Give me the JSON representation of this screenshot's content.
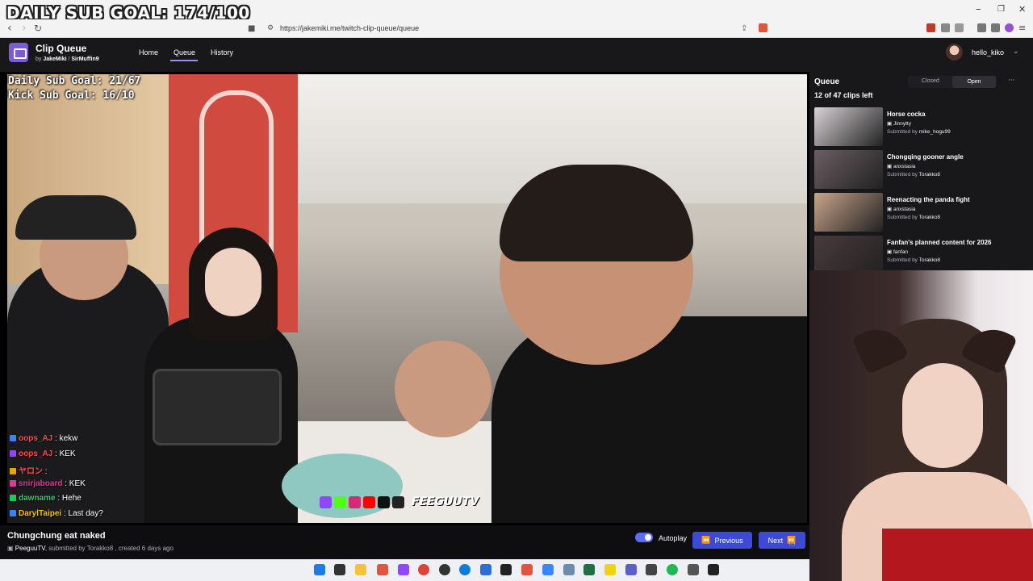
{
  "overlay": {
    "daily_sub_goal_top": "DAILY SUB GOAL: 174/100",
    "daily_sub_goal": "Daily Sub Goal: 21/67",
    "kick_sub_goal": "Kick Sub Goal: 16/10"
  },
  "browser": {
    "url": "https://jakemiki.me/twitch-clip-queue/queue",
    "window_controls": [
      "–",
      "❐",
      "✕"
    ]
  },
  "app": {
    "title": "Clip Queue",
    "by_prefix": "by",
    "authors": [
      "JakeMiki",
      "SirMuffin9"
    ],
    "nav": [
      "Home",
      "Queue",
      "History"
    ],
    "active_nav": "Queue",
    "username": "hello_kiko"
  },
  "player": {
    "clip_title": "Chungchung eat naked",
    "channel": "PeeguuTV",
    "meta_rest": ", submitted by Torakko8 , created 6 days ago",
    "autoplay_label": "Autoplay",
    "autoplay_on": true,
    "previous_label": "Previous",
    "next_label": "Next",
    "watermark": "FEEGUUTV"
  },
  "chat": [
    {
      "user": "oops_AJ",
      "msg": ": kekw",
      "color": "#ff4d4d"
    },
    {
      "user": "oops_AJ",
      "msg": ": KEK",
      "color": "#ff4d4d"
    },
    {
      "user": "ヤロン",
      "msg": ":",
      "color": "#ff4d4d"
    },
    {
      "user": "snirjaboard",
      "msg": ": KEK",
      "color": "#e0379a"
    },
    {
      "user": "dawname",
      "msg": ": Hehe",
      "color": "#2ecc71"
    },
    {
      "user": "DarylTaipei",
      "msg": ": Last day?",
      "color": "#f1c40f"
    }
  ],
  "queue": {
    "title": "Queue",
    "closed_label": "Closed",
    "open_label": "Open",
    "count_text": "12 of 47 clips left",
    "items": [
      {
        "title": "Horse cocka",
        "channel": "Jinnytty",
        "submitted_prefix": "Submitted by ",
        "submitter": "mike_hogu99",
        "thumb": "#d9d2d6"
      },
      {
        "title": "Chongqing gooner angle",
        "channel": "anxstasia",
        "submitted_prefix": "Submitted by ",
        "submitter": "Torakko8",
        "thumb": "#6b5e63"
      },
      {
        "title": "Reenacting the panda fight",
        "channel": "anxstasia",
        "submitted_prefix": "Submitted by ",
        "submitter": "Torakko8",
        "thumb": "#c9a48a"
      },
      {
        "title": "Fanfan's planned content for 2026",
        "channel": "fanfan",
        "submitted_prefix": "Submitted by ",
        "submitter": "Torakko8",
        "thumb": "#4a3a3d"
      }
    ]
  },
  "colors": {
    "accent": "#3d4ad8",
    "app_bg": "#18181b",
    "toggle": "#5c6cff"
  }
}
